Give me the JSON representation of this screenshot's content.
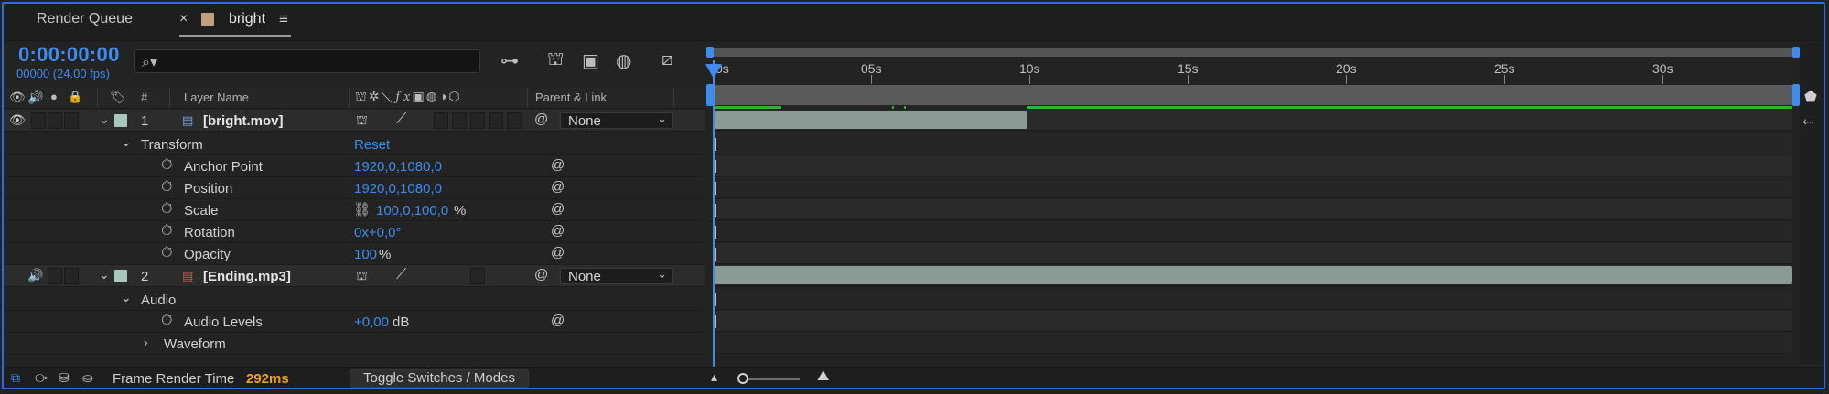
{
  "tabs": [
    {
      "label": "Render Queue",
      "active": false
    },
    {
      "label": "bright",
      "active": true
    }
  ],
  "header": {
    "timecode": "0:00:00:00",
    "fps": "00000 (24.00 fps)",
    "search": {
      "placeholder": "",
      "value": ""
    }
  },
  "columns": {
    "layer_name": "Layer Name",
    "number": "#",
    "parent_link": "Parent & Link"
  },
  "layers": [
    {
      "number": "1",
      "name": "[bright.mov]",
      "parent": "None",
      "label_color": "#a8c8bf",
      "group": "Transform",
      "group_action": "Reset",
      "properties": [
        {
          "name": "Anchor Point",
          "value": "1920,0,1080,0",
          "unit": ""
        },
        {
          "name": "Position",
          "value": "1920,0,1080,0",
          "unit": ""
        },
        {
          "name": "Scale",
          "value": "100,0,100,0",
          "unit": "%"
        },
        {
          "name": "Rotation",
          "value": "0x+0,0°",
          "unit": ""
        },
        {
          "name": "Opacity",
          "value": "100",
          "unit": "%"
        }
      ]
    },
    {
      "number": "2",
      "name": "[Ending.mp3]",
      "parent": "None",
      "label_color": "#a8c8bf",
      "group": "Audio",
      "properties": [
        {
          "name": "Audio Levels",
          "value": "+0,00",
          "unit": "dB"
        }
      ],
      "subgroup": "Waveform"
    }
  ],
  "timeline": {
    "ticks": [
      "0s",
      "05s",
      "10s",
      "15s",
      "20s",
      "25s",
      "30s"
    ]
  },
  "footer": {
    "frame_render_label": "Frame Render Time",
    "frame_render_value": "292ms",
    "toggle_label": "Toggle Switches / Modes"
  },
  "colors": {
    "accent": "#3e8cf0",
    "clip": "#8a9a94",
    "work_area_green": "#2db52d",
    "render_time": "#f0a21c"
  }
}
